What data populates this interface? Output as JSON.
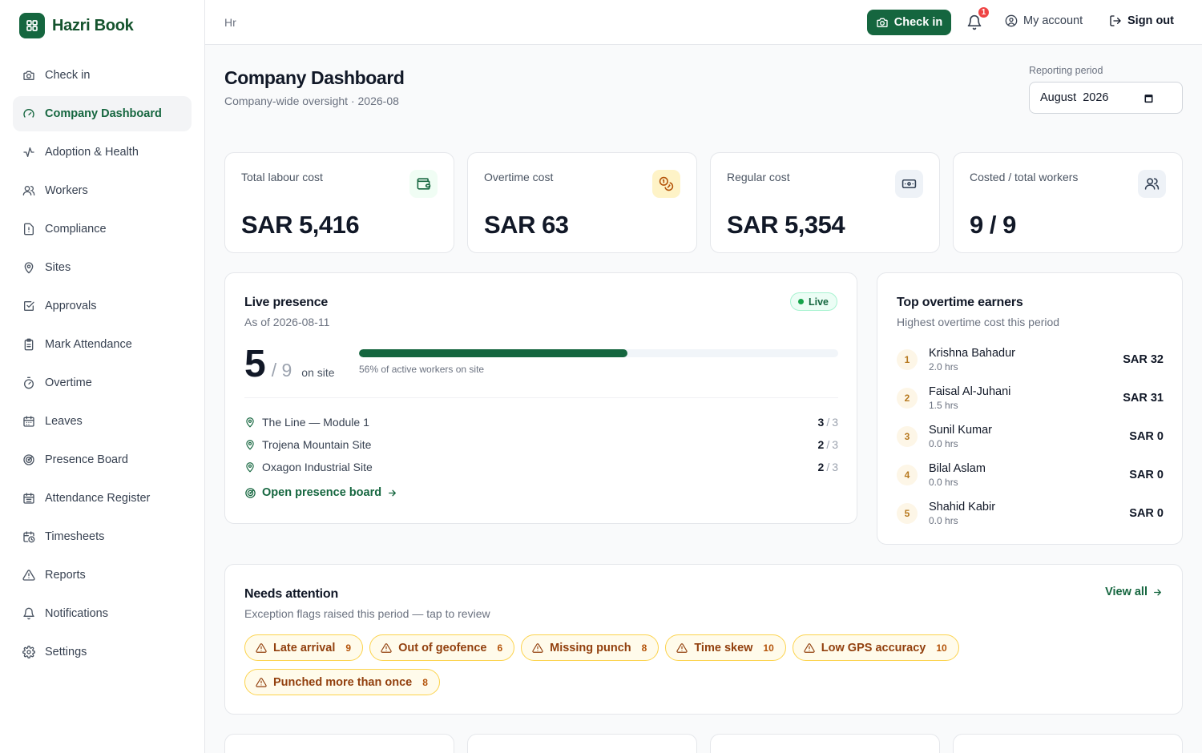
{
  "app": {
    "name": "Hazri Book",
    "breadcrumb": "Hr"
  },
  "sidebar": {
    "items": [
      {
        "label": "Check in",
        "icon": "camera-icon"
      },
      {
        "label": "Company Dashboard",
        "icon": "gauge-icon",
        "active": true
      },
      {
        "label": "Adoption & Health",
        "icon": "activity-icon"
      },
      {
        "label": "Workers",
        "icon": "users-icon"
      },
      {
        "label": "Compliance",
        "icon": "file-alert-icon"
      },
      {
        "label": "Sites",
        "icon": "map-pin-icon"
      },
      {
        "label": "Approvals",
        "icon": "square-check-icon"
      },
      {
        "label": "Mark Attendance",
        "icon": "clipboard-icon"
      },
      {
        "label": "Overtime",
        "icon": "timer-icon"
      },
      {
        "label": "Leaves",
        "icon": "calendar-icon"
      },
      {
        "label": "Presence Board",
        "icon": "radar-icon"
      },
      {
        "label": "Attendance Register",
        "icon": "calendar-grid-icon"
      },
      {
        "label": "Timesheets",
        "icon": "calendar-clock-icon"
      },
      {
        "label": "Reports",
        "icon": "warning-triangle-icon"
      },
      {
        "label": "Notifications",
        "icon": "bell-icon"
      },
      {
        "label": "Settings",
        "icon": "gear-icon"
      }
    ]
  },
  "topbar": {
    "checkin_label": "Check in",
    "notification_count": "1",
    "my_account_label": "My account",
    "sign_out_label": "Sign out"
  },
  "page": {
    "title": "Company Dashboard",
    "subtitle": "Company-wide oversight · 2026-08",
    "period_label": "Reporting period",
    "period_value": "August  2026"
  },
  "stats": [
    {
      "label": "Total labour cost",
      "value": "SAR 5,416",
      "icon": "wallet-icon",
      "tone": "green"
    },
    {
      "label": "Overtime cost",
      "value": "SAR 63",
      "icon": "coins-icon",
      "tone": "amber"
    },
    {
      "label": "Regular cost",
      "value": "SAR 5,354",
      "icon": "banknote-icon",
      "tone": "slate"
    },
    {
      "label": "Costed / total workers",
      "value": "9 / 9",
      "icon": "users-icon",
      "tone": "slate"
    }
  ],
  "presence": {
    "title": "Live presence",
    "as_of": "As of 2026-08-11",
    "live_label": "Live",
    "on_site": "5",
    "total": "/ 9",
    "suffix": "on site",
    "progress_fraction": 0.56,
    "progress_label": "56% of active workers on site",
    "sites": [
      {
        "name": "The Line — Module 1",
        "count": "3",
        "total": "3"
      },
      {
        "name": "Trojena Mountain Site",
        "count": "2",
        "total": "3"
      },
      {
        "name": "Oxagon Industrial Site",
        "count": "2",
        "total": "3"
      }
    ],
    "open_board_label": "Open presence board"
  },
  "earners": {
    "title": "Top overtime earners",
    "subtitle": "Highest overtime cost this period",
    "items": [
      {
        "rank": "1",
        "name": "Krishna Bahadur",
        "hours": "2.0 hrs",
        "amount": "SAR 32"
      },
      {
        "rank": "2",
        "name": "Faisal Al-Juhani",
        "hours": "1.5 hrs",
        "amount": "SAR 31"
      },
      {
        "rank": "3",
        "name": "Sunil Kumar",
        "hours": "0.0 hrs",
        "amount": "SAR 0"
      },
      {
        "rank": "4",
        "name": "Bilal Aslam",
        "hours": "0.0 hrs",
        "amount": "SAR 0"
      },
      {
        "rank": "5",
        "name": "Shahid Kabir",
        "hours": "0.0 hrs",
        "amount": "SAR 0"
      }
    ]
  },
  "attention": {
    "title": "Needs attention",
    "subtitle": "Exception flags raised this period — tap to review",
    "view_all_label": "View all",
    "flags": [
      {
        "label": "Late arrival",
        "count": "9"
      },
      {
        "label": "Out of geofence",
        "count": "6"
      },
      {
        "label": "Missing punch",
        "count": "8"
      },
      {
        "label": "Time skew",
        "count": "10"
      },
      {
        "label": "Low GPS accuracy",
        "count": "10"
      },
      {
        "label": "Punched more than once",
        "count": "8"
      }
    ]
  },
  "colors": {
    "brand": "#15663f",
    "warning_bg": "#fffbeb",
    "warning_text": "#92400e",
    "danger": "#ef4444"
  }
}
